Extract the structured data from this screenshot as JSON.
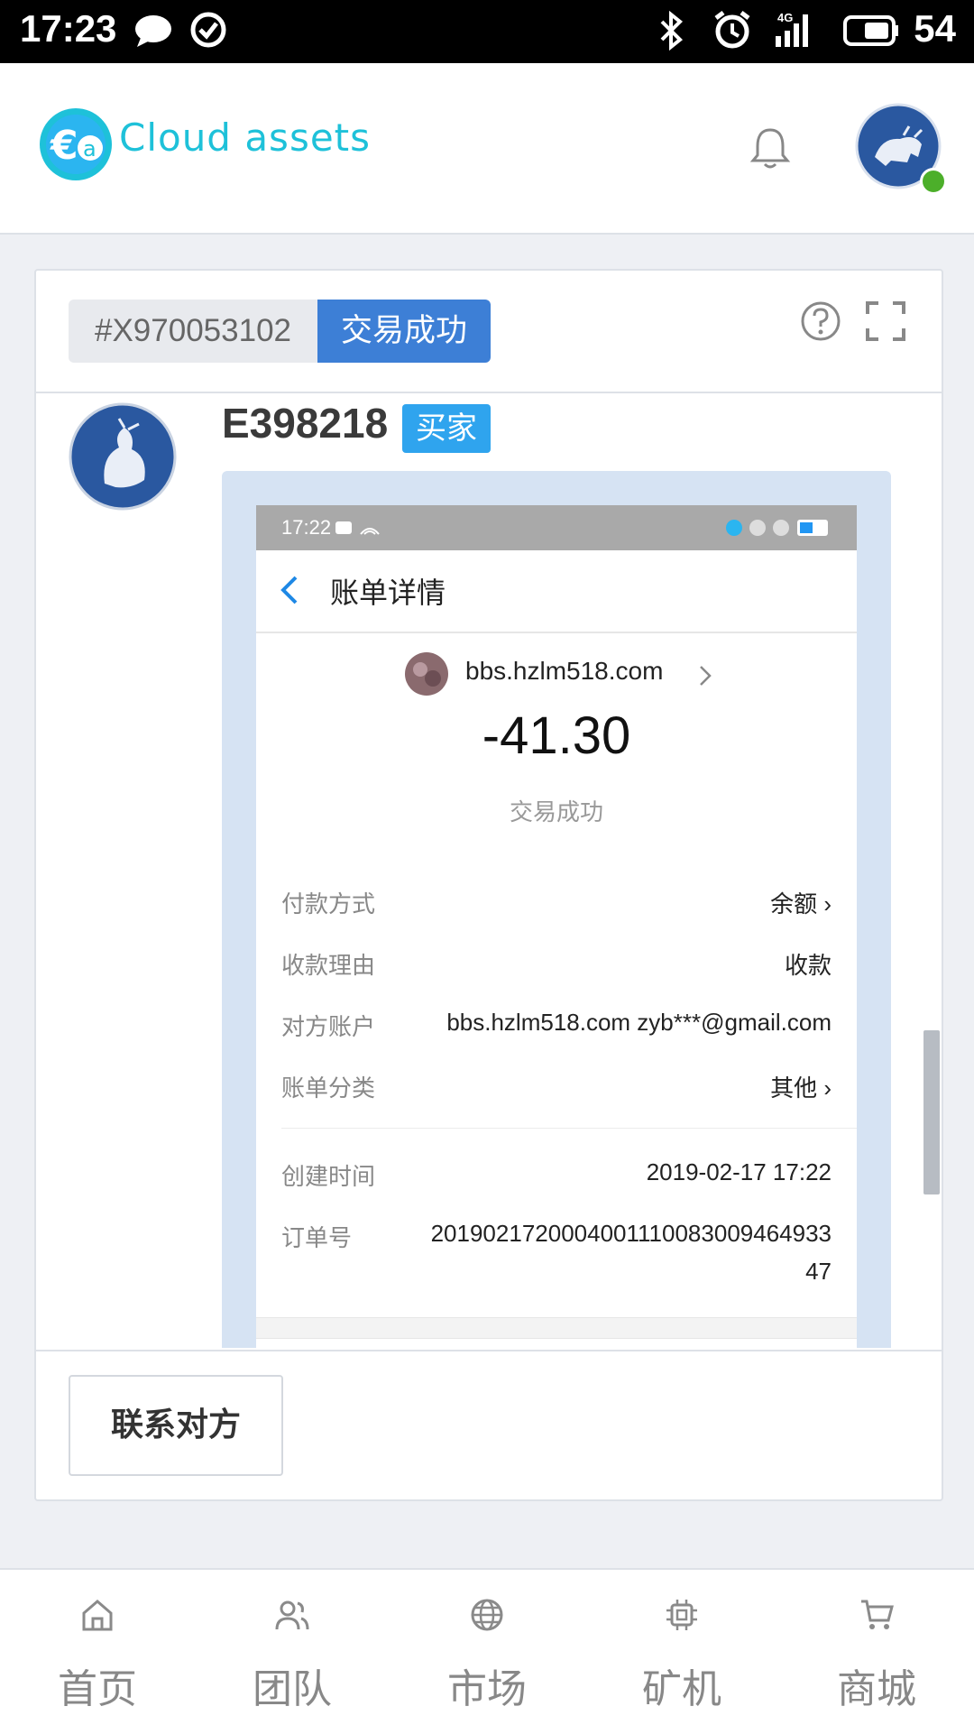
{
  "status_bar": {
    "time": "17:23",
    "battery": "54"
  },
  "header": {
    "app_name": "Cloud assets"
  },
  "order": {
    "id": "#X970053102",
    "status": "交易成功",
    "user": "E398218",
    "role_badge": "买家",
    "contact_button": "联系对方"
  },
  "screenshot": {
    "time": "17:22",
    "title": "账单详情",
    "merchant": "bbs.hzlm518.com",
    "amount": "-41.30",
    "status": "交易成功",
    "rows": [
      {
        "label": "付款方式",
        "value": "余额 ›"
      },
      {
        "label": "收款理由",
        "value": "收款"
      },
      {
        "label": "对方账户",
        "value": "bbs.hzlm518.com zyb***@gmail.com"
      },
      {
        "label": "账单分类",
        "value": "其他 ›"
      },
      {
        "label": "创建时间",
        "value": "2019-02-17 17:22"
      },
      {
        "label": "订单号",
        "value": "2019021720004001110083009464933",
        "value2": "47"
      }
    ]
  },
  "bottom_nav": {
    "items": [
      {
        "label": "首页",
        "icon": "home-icon"
      },
      {
        "label": "团队",
        "icon": "team-icon"
      },
      {
        "label": "市场",
        "icon": "globe-icon"
      },
      {
        "label": "矿机",
        "icon": "chip-icon"
      },
      {
        "label": "商城",
        "icon": "cart-icon"
      }
    ]
  },
  "colors": {
    "accent": "#3d7fd6",
    "badge": "#2fa4ee",
    "logo": "#1ec1d9",
    "online": "#4caf2a"
  }
}
